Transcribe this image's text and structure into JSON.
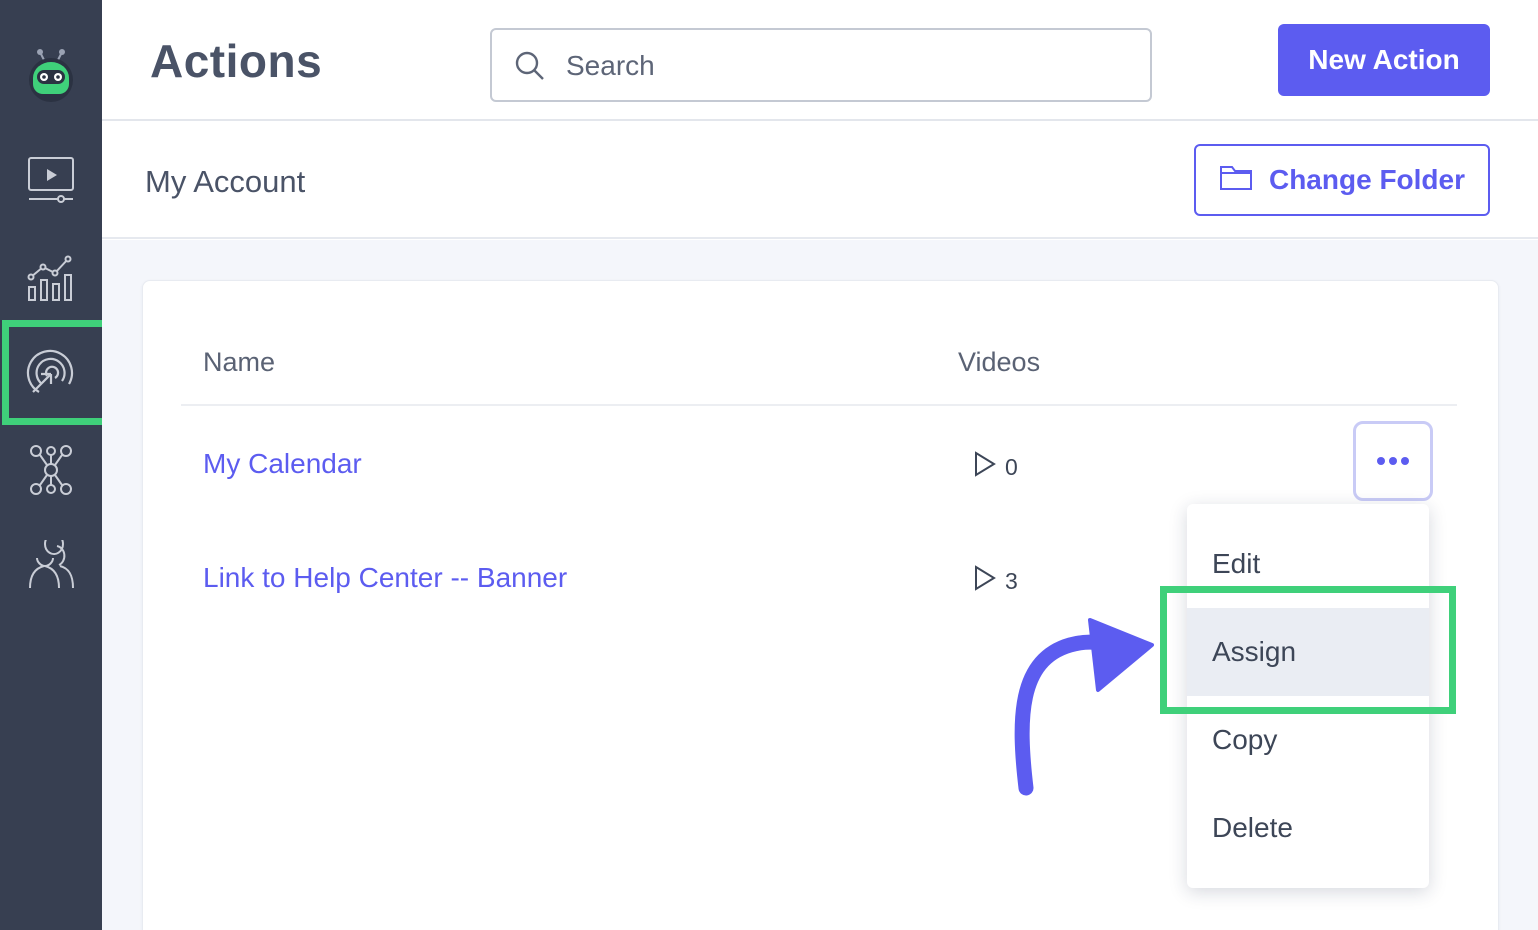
{
  "header": {
    "title": "Actions",
    "search": {
      "placeholder": "Search",
      "value": ""
    },
    "new_action_label": "New Action"
  },
  "subheader": {
    "account_title": "My Account",
    "change_folder_label": "Change Folder"
  },
  "sidebar": {
    "items": [
      {
        "icon": "robot-logo-icon"
      },
      {
        "icon": "video-player-icon"
      },
      {
        "icon": "analytics-chart-icon"
      },
      {
        "icon": "actions-target-icon",
        "selected": true
      },
      {
        "icon": "integrations-network-icon"
      },
      {
        "icon": "users-icon"
      }
    ]
  },
  "table": {
    "columns": [
      "Name",
      "Videos"
    ],
    "rows": [
      {
        "name": "My Calendar",
        "videos": "0"
      },
      {
        "name": "Link to Help Center -- Banner",
        "videos": "3"
      }
    ]
  },
  "row_menu": {
    "items": [
      "Edit",
      "Assign",
      "Copy",
      "Delete"
    ],
    "highlighted": "Assign"
  },
  "colors": {
    "accent": "#5c5cf0",
    "sidebar": "#373f51",
    "highlight": "#3fd07a",
    "logo_green": "#3fd07a"
  }
}
